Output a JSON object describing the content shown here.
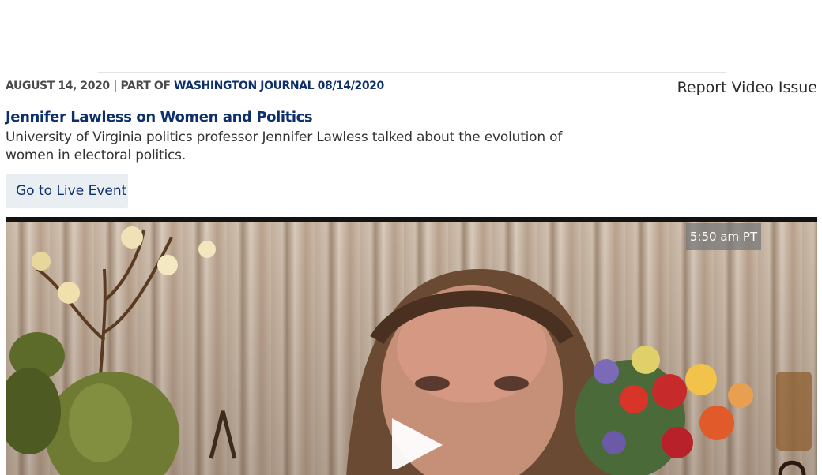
{
  "meta": {
    "date": "AUGUST 14, 2020",
    "separator": "|",
    "part_of_label": "PART OF",
    "program": "WASHINGTON JOURNAL 08/14/2020"
  },
  "report_link": "Report Video Issue",
  "video": {
    "title": "Jennifer Lawless on Women and Politics",
    "description": "University of Virginia politics professor Jennifer Lawless talked about the evolution of women in electoral politics."
  },
  "live_event_button": "Go to Live Event",
  "player": {
    "timestamp": "5:50 am PT",
    "play_icon": "play-icon"
  },
  "colors": {
    "brand_navy": "#0d2f6b",
    "button_bg": "#e8eef2",
    "meta_gray": "#4a4a4a"
  }
}
